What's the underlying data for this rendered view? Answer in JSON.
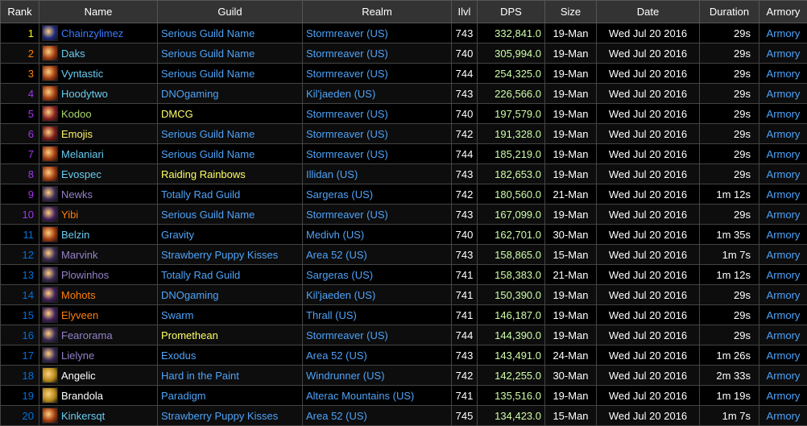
{
  "columns": [
    "Rank",
    "Name",
    "Guild",
    "Realm",
    "Ilvl",
    "DPS",
    "Size",
    "Date",
    "Duration",
    "Armory"
  ],
  "colors": {
    "header_bg": "#333333",
    "link": "#4fa3f7",
    "dps": "#cfffaa",
    "date": "#ffffff",
    "duration": "#ffffff"
  },
  "rows": [
    {
      "rank": "1",
      "name": "Chainzylimez",
      "guild": "Serious Guild Name",
      "realm": "Stormreaver (US)",
      "ilvl": "743",
      "dps": "332,841.0",
      "size": "19-Man",
      "date": "Wed Jul 20 2016",
      "duration": "29s",
      "armory": "Armory",
      "name_color": "#3b7bff",
      "guild_color": "#4fa3f7",
      "rank_color": "#ffff00",
      "icon": "frost-bolt-icon",
      "icon_bg": "#1f2a7a"
    },
    {
      "rank": "2",
      "name": "Daks",
      "guild": "Serious Guild Name",
      "realm": "Stormreaver (US)",
      "ilvl": "740",
      "dps": "305,994.0",
      "size": "19-Man",
      "date": "Wed Jul 20 2016",
      "duration": "29s",
      "armory": "Armory",
      "name_color": "#69ccf0",
      "guild_color": "#4fa3f7",
      "rank_color": "#ff8000",
      "icon": "fire-mage-icon",
      "icon_bg": "#a03a10"
    },
    {
      "rank": "3",
      "name": "Vyntastic",
      "guild": "Serious Guild Name",
      "realm": "Stormreaver (US)",
      "ilvl": "744",
      "dps": "254,325.0",
      "size": "19-Man",
      "date": "Wed Jul 20 2016",
      "duration": "29s",
      "armory": "Armory",
      "name_color": "#69ccf0",
      "guild_color": "#4fa3f7",
      "rank_color": "#ff8000",
      "icon": "fire-mage-icon",
      "icon_bg": "#a03a10"
    },
    {
      "rank": "4",
      "name": "Hoodytwo",
      "guild": "DNOgaming",
      "realm": "Kil'jaeden (US)",
      "ilvl": "743",
      "dps": "226,566.0",
      "size": "19-Man",
      "date": "Wed Jul 20 2016",
      "duration": "29s",
      "armory": "Armory",
      "name_color": "#69ccf0",
      "guild_color": "#4fa3f7",
      "rank_color": "#a335ee",
      "icon": "fire-mage-icon",
      "icon_bg": "#a03a10"
    },
    {
      "rank": "5",
      "name": "Kodoo",
      "guild": "DMCG",
      "realm": "Stormreaver (US)",
      "ilvl": "740",
      "dps": "197,579.0",
      "size": "19-Man",
      "date": "Wed Jul 20 2016",
      "duration": "29s",
      "armory": "Armory",
      "name_color": "#abd473",
      "guild_color": "#ffff66",
      "rank_color": "#a335ee",
      "icon": "hunter-pet-icon",
      "icon_bg": "#8a2020"
    },
    {
      "rank": "6",
      "name": "Emojis",
      "guild": "Serious Guild Name",
      "realm": "Stormreaver (US)",
      "ilvl": "742",
      "dps": "191,328.0",
      "size": "19-Man",
      "date": "Wed Jul 20 2016",
      "duration": "29s",
      "armory": "Armory",
      "name_color": "#fff569",
      "guild_color": "#4fa3f7",
      "rank_color": "#a335ee",
      "icon": "rogue-blade-icon",
      "icon_bg": "#7a1a1a"
    },
    {
      "rank": "7",
      "name": "Melaniari",
      "guild": "Serious Guild Name",
      "realm": "Stormreaver (US)",
      "ilvl": "744",
      "dps": "185,219.0",
      "size": "19-Man",
      "date": "Wed Jul 20 2016",
      "duration": "29s",
      "armory": "Armory",
      "name_color": "#69ccf0",
      "guild_color": "#4fa3f7",
      "rank_color": "#a335ee",
      "icon": "fire-mage-icon",
      "icon_bg": "#a03a10"
    },
    {
      "rank": "8",
      "name": "Evospec",
      "guild": "Raiding Rainbows",
      "realm": "Illidan (US)",
      "ilvl": "743",
      "dps": "182,653.0",
      "size": "19-Man",
      "date": "Wed Jul 20 2016",
      "duration": "29s",
      "armory": "Armory",
      "name_color": "#69ccf0",
      "guild_color": "#ffff66",
      "rank_color": "#a335ee",
      "icon": "fire-mage-icon",
      "icon_bg": "#a03a10"
    },
    {
      "rank": "9",
      "name": "Newks",
      "guild": "Totally Rad Guild",
      "realm": "Sargeras (US)",
      "ilvl": "742",
      "dps": "180,560.0",
      "size": "21-Man",
      "date": "Wed Jul 20 2016",
      "duration": "1m 12s",
      "armory": "Armory",
      "name_color": "#9482c9",
      "guild_color": "#4fa3f7",
      "rank_color": "#a335ee",
      "icon": "warlock-demon-icon",
      "icon_bg": "#3a2a55"
    },
    {
      "rank": "10",
      "name": "Yibi",
      "guild": "Serious Guild Name",
      "realm": "Stormreaver (US)",
      "ilvl": "743",
      "dps": "167,099.0",
      "size": "19-Man",
      "date": "Wed Jul 20 2016",
      "duration": "29s",
      "armory": "Armory",
      "name_color": "#ff7d0a",
      "guild_color": "#4fa3f7",
      "rank_color": "#a335ee",
      "icon": "balance-druid-icon",
      "icon_bg": "#40205a"
    },
    {
      "rank": "11",
      "name": "Belzin",
      "guild": "Gravity",
      "realm": "Medivh (US)",
      "ilvl": "740",
      "dps": "162,701.0",
      "size": "30-Man",
      "date": "Wed Jul 20 2016",
      "duration": "1m 35s",
      "armory": "Armory",
      "name_color": "#69ccf0",
      "guild_color": "#4fa3f7",
      "rank_color": "#0070dd",
      "icon": "fire-mage-icon",
      "icon_bg": "#a03a10"
    },
    {
      "rank": "12",
      "name": "Marvink",
      "guild": "Strawberry Puppy Kisses",
      "realm": "Area 52 (US)",
      "ilvl": "743",
      "dps": "158,865.0",
      "size": "15-Man",
      "date": "Wed Jul 20 2016",
      "duration": "1m 7s",
      "armory": "Armory",
      "name_color": "#9482c9",
      "guild_color": "#4fa3f7",
      "rank_color": "#0070dd",
      "icon": "warlock-demon-icon",
      "icon_bg": "#3a2a55"
    },
    {
      "rank": "13",
      "name": "Plowinhos",
      "guild": "Totally Rad Guild",
      "realm": "Sargeras (US)",
      "ilvl": "741",
      "dps": "158,383.0",
      "size": "21-Man",
      "date": "Wed Jul 20 2016",
      "duration": "1m 12s",
      "armory": "Armory",
      "name_color": "#9482c9",
      "guild_color": "#4fa3f7",
      "rank_color": "#0070dd",
      "icon": "warlock-demon-icon",
      "icon_bg": "#3a2a55"
    },
    {
      "rank": "14",
      "name": "Mohots",
      "guild": "DNOgaming",
      "realm": "Kil'jaeden (US)",
      "ilvl": "741",
      "dps": "150,390.0",
      "size": "19-Man",
      "date": "Wed Jul 20 2016",
      "duration": "29s",
      "armory": "Armory",
      "name_color": "#ff7d0a",
      "guild_color": "#4fa3f7",
      "rank_color": "#0070dd",
      "icon": "balance-druid-icon",
      "icon_bg": "#40205a"
    },
    {
      "rank": "15",
      "name": "Elyveen",
      "guild": "Swarm",
      "realm": "Thrall (US)",
      "ilvl": "741",
      "dps": "146,187.0",
      "size": "19-Man",
      "date": "Wed Jul 20 2016",
      "duration": "29s",
      "armory": "Armory",
      "name_color": "#ff7d0a",
      "guild_color": "#4fa3f7",
      "rank_color": "#0070dd",
      "icon": "balance-druid-icon",
      "icon_bg": "#40205a"
    },
    {
      "rank": "16",
      "name": "Fearorama",
      "guild": "Promethean",
      "realm": "Stormreaver (US)",
      "ilvl": "744",
      "dps": "144,390.0",
      "size": "19-Man",
      "date": "Wed Jul 20 2016",
      "duration": "29s",
      "armory": "Armory",
      "name_color": "#9482c9",
      "guild_color": "#ffff66",
      "rank_color": "#0070dd",
      "icon": "warlock-demon-icon",
      "icon_bg": "#3a2a55"
    },
    {
      "rank": "17",
      "name": "Lielyne",
      "guild": "Exodus",
      "realm": "Area 52 (US)",
      "ilvl": "743",
      "dps": "143,491.0",
      "size": "24-Man",
      "date": "Wed Jul 20 2016",
      "duration": "1m 26s",
      "armory": "Armory",
      "name_color": "#9482c9",
      "guild_color": "#4fa3f7",
      "rank_color": "#0070dd",
      "icon": "warlock-demon-icon",
      "icon_bg": "#3a2a55"
    },
    {
      "rank": "18",
      "name": "Angelic",
      "guild": "Hard in the Paint",
      "realm": "Windrunner (US)",
      "ilvl": "742",
      "dps": "142,255.0",
      "size": "30-Man",
      "date": "Wed Jul 20 2016",
      "duration": "2m 33s",
      "armory": "Armory",
      "name_color": "#ffffff",
      "guild_color": "#4fa3f7",
      "rank_color": "#0070dd",
      "icon": "priest-shadow-icon",
      "icon_bg": "#b5891a"
    },
    {
      "rank": "19",
      "name": "Brandola",
      "guild": "Paradigm",
      "realm": "Alterac Mountains (US)",
      "ilvl": "741",
      "dps": "135,516.0",
      "size": "19-Man",
      "date": "Wed Jul 20 2016",
      "duration": "1m 19s",
      "armory": "Armory",
      "name_color": "#ffffff",
      "guild_color": "#4fa3f7",
      "rank_color": "#0070dd",
      "icon": "priest-shadow-icon",
      "icon_bg": "#b5891a"
    },
    {
      "rank": "20",
      "name": "Kinkersqt",
      "guild": "Strawberry Puppy Kisses",
      "realm": "Area 52 (US)",
      "ilvl": "745",
      "dps": "134,423.0",
      "size": "15-Man",
      "date": "Wed Jul 20 2016",
      "duration": "1m 7s",
      "armory": "Armory",
      "name_color": "#69ccf0",
      "guild_color": "#4fa3f7",
      "rank_color": "#0070dd",
      "icon": "fire-mage-icon",
      "icon_bg": "#a03a10"
    }
  ]
}
